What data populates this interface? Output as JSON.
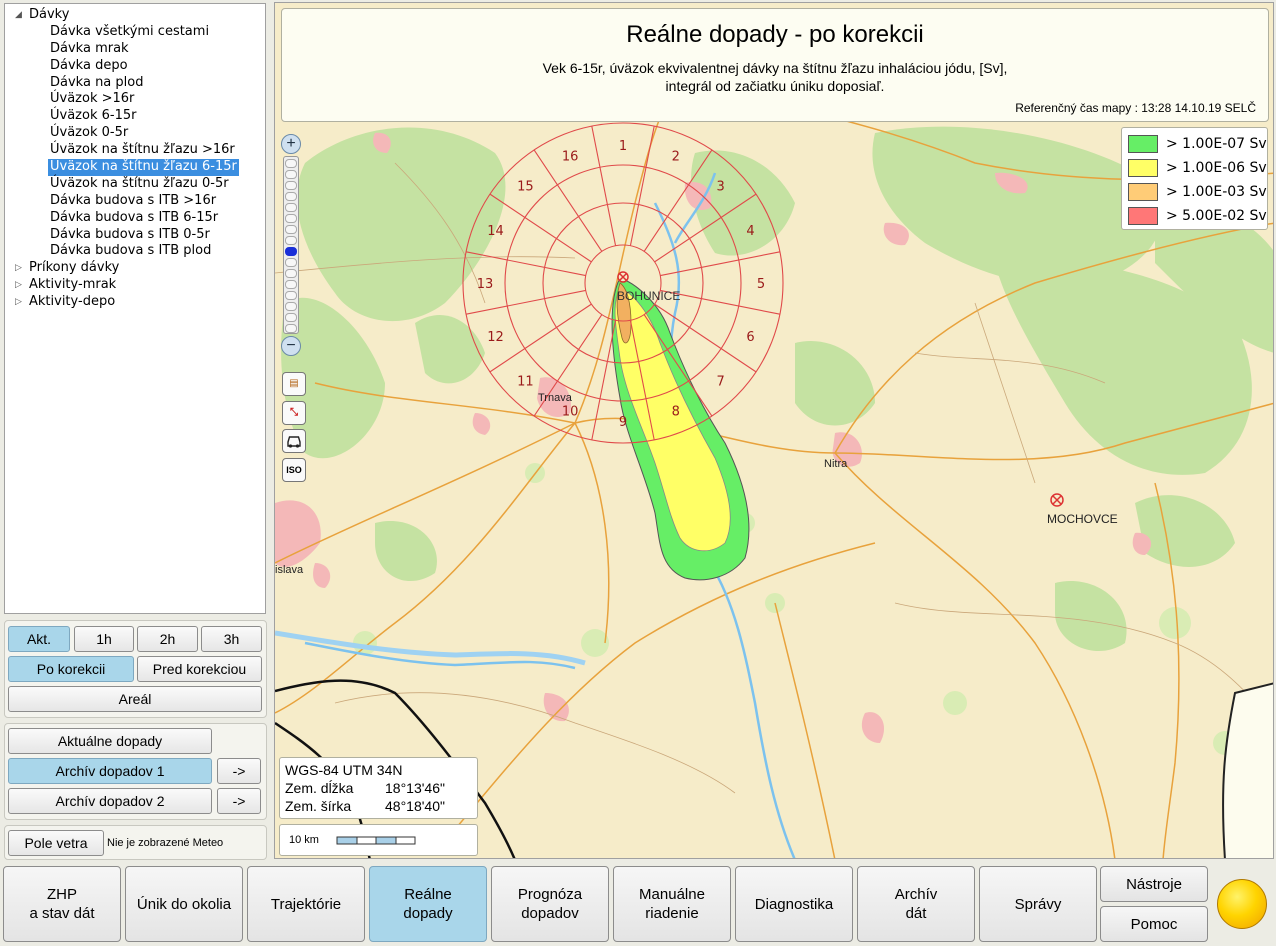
{
  "tree": [
    {
      "label": "Dávky",
      "expanded": true,
      "children": [
        "Dávka všetkými cestami",
        "Dávka mrak",
        "Dávka depo",
        "Dávka na plod",
        "Úväzok >16r",
        "Úväzok 6-15r",
        "Úväzok 0-5r",
        "Úväzok na štítnu žľazu >16r",
        "Úväzok na štítnu žľazu 6-15r",
        "Úväzok na štítnu žľazu 0-5r",
        "Dávka budova s ITB >16r",
        "Dávka budova s ITB 6-15r",
        "Dávka budova s ITB 0-5r",
        "Dávka budova s ITB plod"
      ]
    },
    {
      "label": "Príkony dávky",
      "expanded": false
    },
    {
      "label": "Aktivity-mrak",
      "expanded": false
    },
    {
      "label": "Aktivity-depo",
      "expanded": false
    }
  ],
  "tree_selected": "Úväzok na štítnu žľazu 6-15r",
  "time_buttons": [
    "Akt.",
    "1h",
    "2h",
    "3h"
  ],
  "time_active": "Akt.",
  "correction_buttons": [
    "Po korekcii",
    "Pred korekciou"
  ],
  "correction_active": "Po korekcii",
  "areal_label": "Areál",
  "impacts": {
    "current": "Aktuálne dopady",
    "archive1": "Archív dopadov 1",
    "archive2": "Archív dopadov 2",
    "arrow": "->"
  },
  "wind": {
    "button": "Pole vetra",
    "status": "Nie je zobrazené Meteo"
  },
  "map_title": {
    "title": "Reálne dopady - po korekcii",
    "line1": "Vek 6-15r, úväzok ekvivalentnej dávky na štítnu žľazu inhaláciou jódu, [Sv],",
    "line2": "integrál od začiatku úniku doposiaľ.",
    "ref_time": "Referenčný čas mapy : 13:28 14.10.19 SELČ"
  },
  "legend": [
    {
      "label": "> 1.00E-07 Sv",
      "color": "#66ee66"
    },
    {
      "label": "> 1.00E-06 Sv",
      "color": "#ffff66"
    },
    {
      "label": "> 1.00E-03 Sv",
      "color": "#ffcc77"
    },
    {
      "label": "> 5.00E-02 Sv",
      "color": "#ff7777"
    }
  ],
  "zoom": {
    "plus": "+",
    "minus": "−"
  },
  "tools": [
    {
      "icon": "layers-icon",
      "glyph": "▤"
    },
    {
      "icon": "measure-icon",
      "glyph": "⤡"
    },
    {
      "icon": "car-icon",
      "glyph": "🚗"
    },
    {
      "icon": "iso-icon",
      "glyph": "ISO"
    }
  ],
  "sectors": [
    "1",
    "2",
    "3",
    "4",
    "5",
    "6",
    "7",
    "8",
    "9",
    "10",
    "11",
    "12",
    "13",
    "14",
    "15",
    "16"
  ],
  "places": {
    "bohunice": "BOHUNICE",
    "trnava": "Trnava",
    "nitra": "Nitra",
    "mochovce": "MOCHOVCE",
    "bratislava": "islava"
  },
  "coords": {
    "system": "WGS-84 UTM 34N",
    "lon_label": "Zem. dĺžka",
    "lon": "18°13'46\"",
    "lat_label": "Zem. šírka",
    "lat": "48°18'40\""
  },
  "scale_label": "10 km",
  "nav": [
    {
      "label": "ZHP\na stav dát",
      "active": false
    },
    {
      "label": "Únik do okolia",
      "active": false
    },
    {
      "label": "Trajektórie",
      "active": false
    },
    {
      "label": "Reálne\ndopady",
      "active": true
    },
    {
      "label": "Prognóza\ndopadov",
      "active": false
    },
    {
      "label": "Manuálne\nriadenie",
      "active": false
    },
    {
      "label": "Diagnostika",
      "active": false
    },
    {
      "label": "Archív\ndát",
      "active": false
    },
    {
      "label": "Správy",
      "active": false
    }
  ],
  "nav_tools": "Nástroje",
  "nav_help": "Pomoc"
}
